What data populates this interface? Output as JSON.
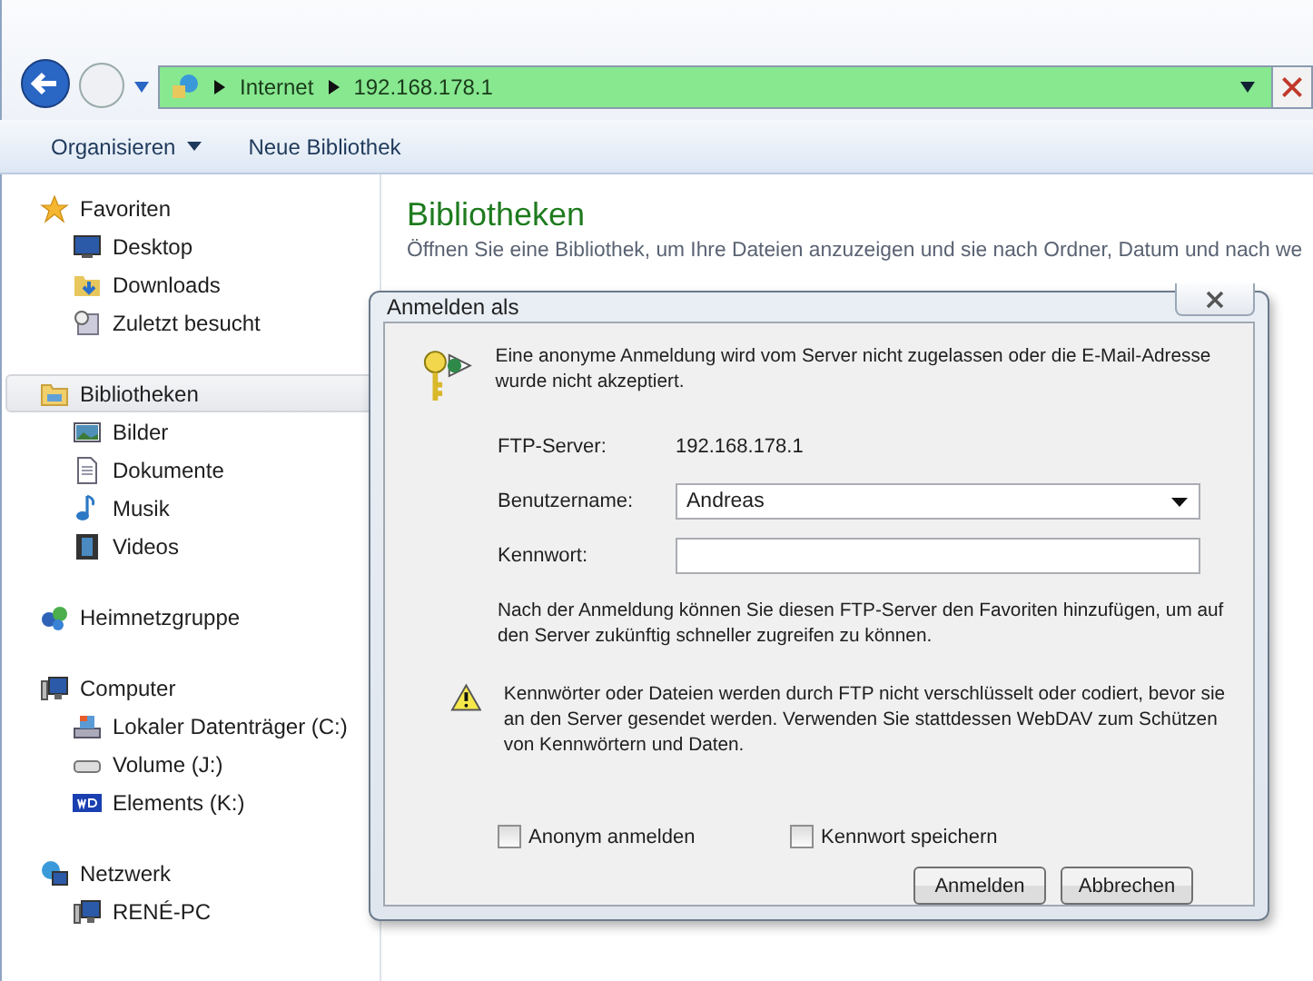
{
  "address_bar": {
    "segments": [
      "Internet",
      "192.168.178.1"
    ]
  },
  "toolbar": {
    "items": [
      {
        "label": "Organisieren",
        "kind": "menu"
      },
      {
        "label": "Neue Bibliothek",
        "kind": "button"
      }
    ]
  },
  "sidebar": {
    "groups": [
      {
        "label": "Favoriten",
        "kind": "star",
        "selected": false,
        "children": [
          {
            "label": "Desktop",
            "kind": "desktop"
          },
          {
            "label": "Downloads",
            "kind": "download"
          },
          {
            "label": "Zuletzt besucht",
            "kind": "recent"
          }
        ]
      },
      {
        "label": "Bibliotheken",
        "kind": "library",
        "selected": true,
        "children": [
          {
            "label": "Bilder",
            "kind": "picture"
          },
          {
            "label": "Dokumente",
            "kind": "document"
          },
          {
            "label": "Musik",
            "kind": "music"
          },
          {
            "label": "Videos",
            "kind": "video"
          }
        ]
      },
      {
        "label": "Heimnetzgruppe",
        "kind": "homegroup",
        "selected": false
      },
      {
        "label": "Computer",
        "kind": "computer",
        "selected": false,
        "children": [
          {
            "label": "Lokaler Datenträger (C:)",
            "kind": "drive"
          },
          {
            "label": "Volume (J:)",
            "kind": "removable"
          },
          {
            "label": "Elements (K:)",
            "kind": "wd"
          }
        ]
      },
      {
        "label": "Netzwerk",
        "kind": "network",
        "selected": false,
        "children": [
          {
            "label": "RENÉ-PC",
            "kind": "computer"
          }
        ]
      }
    ]
  },
  "content": {
    "title": "Bibliotheken",
    "subtitle": "Öffnen Sie eine Bibliothek, um Ihre Dateien anzuzeigen und sie nach Ordner, Datum und nach we"
  },
  "dialog": {
    "title": "Anmelden als",
    "message": "Eine anonyme Anmeldung wird vom Server nicht zugelassen oder die E-Mail-Adresse wurde nicht akzeptiert.",
    "server_label": "FTP-Server:",
    "server_value": "192.168.178.1",
    "username_label": "Benutzername:",
    "username_value": "Andreas",
    "password_label": "Kennwort:",
    "info": "Nach der Anmeldung können Sie diesen FTP-Server den Favoriten hinzufügen, um auf den Server zukünftig schneller zugreifen zu können.",
    "warning": "Kennwörter oder Dateien werden durch FTP nicht verschlüsselt oder codiert, bevor sie an den Server gesendet werden. Verwenden Sie stattdessen WebDAV zum Schützen von Kennwörtern und Daten.",
    "checkboxes": [
      {
        "label": "Anonym anmelden",
        "checked": false
      },
      {
        "label": "Kennwort speichern",
        "checked": false
      }
    ],
    "buttons": [
      {
        "label": "Anmelden"
      },
      {
        "label": "Abbrechen"
      }
    ]
  }
}
